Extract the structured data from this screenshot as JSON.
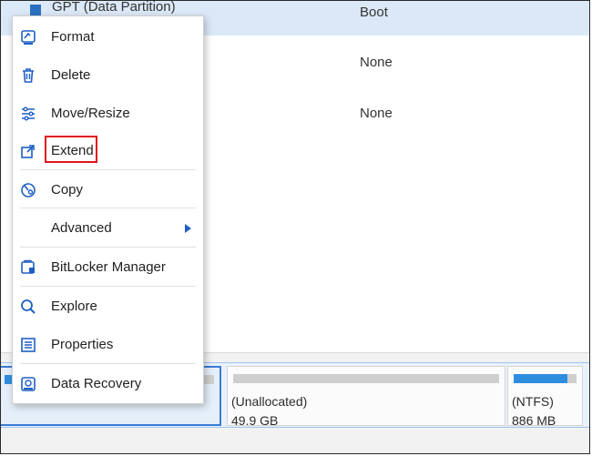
{
  "partition_rows": [
    {
      "name": "GPT (Data Partition)",
      "type": "Boot"
    },
    {
      "type": "None"
    },
    {
      "type": "None"
    }
  ],
  "context_menu": {
    "items": [
      {
        "id": "format",
        "label": "Format",
        "icon": "format-icon"
      },
      {
        "id": "delete",
        "label": "Delete",
        "icon": "trash-icon"
      },
      {
        "id": "move-resize",
        "label": "Move/Resize",
        "icon": "sliders-icon"
      },
      {
        "id": "extend",
        "label": "Extend",
        "icon": "extend-icon"
      },
      {
        "id": "copy",
        "label": "Copy",
        "icon": "copy-icon"
      },
      {
        "id": "advanced",
        "label": "Advanced",
        "icon": "chevron-right-icon"
      },
      {
        "id": "bitlocker",
        "label": "BitLocker Manager",
        "icon": "bitlocker-icon"
      },
      {
        "id": "explore",
        "label": "Explore",
        "icon": "search-icon"
      },
      {
        "id": "properties",
        "label": "Properties",
        "icon": "list-icon"
      },
      {
        "id": "data-recovery",
        "label": "Data Recovery",
        "icon": "recovery-icon"
      }
    ]
  },
  "disk_map": {
    "partitions": [
      {
        "label": "(Unallocated)",
        "size": "49.9 GB",
        "used_fraction": 0.0
      },
      {
        "label": "(NTFS)",
        "size": "886 MB",
        "used_fraction": 0.85
      }
    ],
    "selected_used_fraction": 0.95
  },
  "colors": {
    "accent": "#2f8de0",
    "highlight": "#e0141e",
    "icon": "#1f5fc4"
  }
}
